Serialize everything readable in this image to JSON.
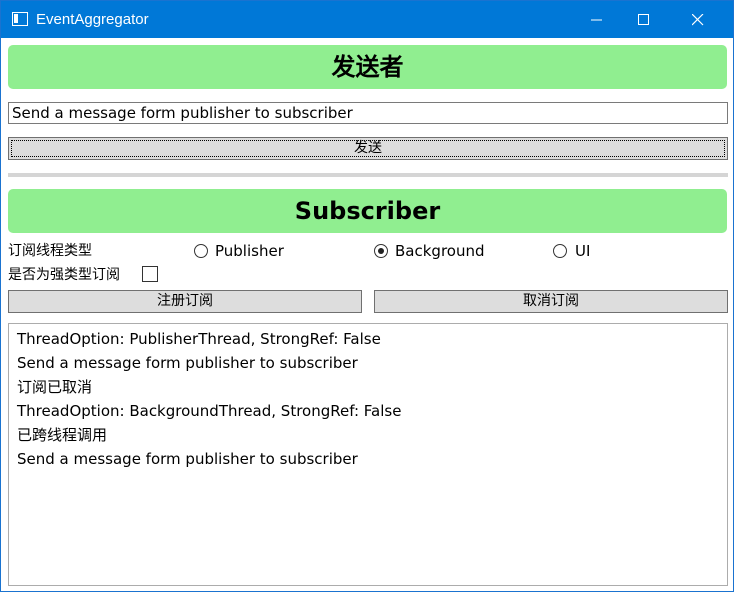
{
  "window": {
    "title": "EventAggregator",
    "title_bar_color": "#0078d7",
    "icons": {
      "minimize": "minimize-icon",
      "maximize": "maximize-icon",
      "close": "close-icon"
    }
  },
  "sender": {
    "header": "发送者",
    "message_value": "Send a message form publisher to subscriber",
    "send_button": "发送"
  },
  "subscriber": {
    "header": "Subscriber",
    "thread_type_label": "订阅线程类型",
    "thread_options": [
      {
        "label": "Publisher",
        "checked": false
      },
      {
        "label": "Background",
        "checked": true
      },
      {
        "label": "UI",
        "checked": false
      }
    ],
    "strong_ref_label": "是否为强类型订阅",
    "strong_ref_checked": false,
    "register_button": "注册订阅",
    "unregister_button": "取消订阅",
    "log": [
      "ThreadOption: PublisherThread, StrongRef: False",
      "Send a message form publisher to subscriber",
      "订阅已取消",
      "ThreadOption: BackgroundThread, StrongRef: False",
      "已跨线程调用",
      "Send a message form publisher to subscriber"
    ]
  },
  "colors": {
    "banner": "#90ee90",
    "button": "#dddddd",
    "separator": "#d5d5d5"
  }
}
